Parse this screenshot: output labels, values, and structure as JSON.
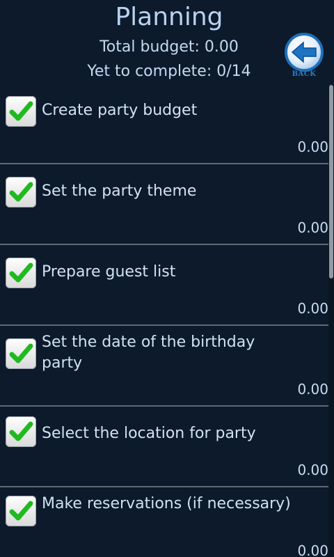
{
  "header": {
    "title": "Planning",
    "total_budget": "Total budget: 0.00",
    "yet_to_complete": "Yet to complete: 0/14",
    "back_label": "BACK",
    "back_icon": "left-arrow-icon"
  },
  "tasks": [
    {
      "label": "Create party budget",
      "amount": "0.00",
      "checked": true
    },
    {
      "label": "Set the party theme",
      "amount": "0.00",
      "checked": true
    },
    {
      "label": "Prepare guest list",
      "amount": "0.00",
      "checked": true
    },
    {
      "label": "Set the date of the birthday party",
      "amount": "0.00",
      "checked": true
    },
    {
      "label": "Select the location for party",
      "amount": "0.00",
      "checked": true
    },
    {
      "label": "Make reservations (if necessary)",
      "amount": "0.00",
      "checked": true
    }
  ],
  "colors": {
    "background": "#0c1a2b",
    "title": "#b9d2f0",
    "check_green": "#1fba1f",
    "back_blue": "#2a7fc8",
    "divider": "#5f6a73"
  }
}
